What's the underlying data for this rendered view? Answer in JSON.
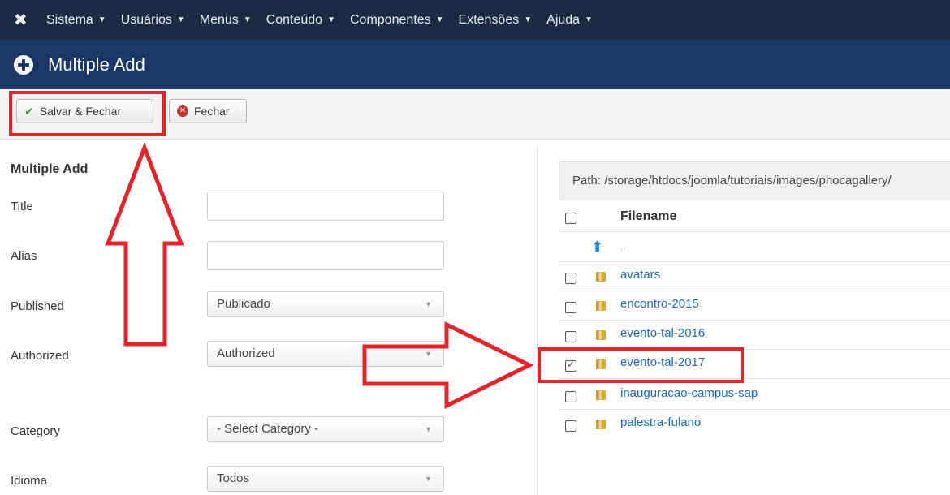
{
  "nav": {
    "logo_icon": "joomla-logo-icon",
    "items": [
      {
        "label": "Sistema"
      },
      {
        "label": "Usuários"
      },
      {
        "label": "Menus"
      },
      {
        "label": "Conteúdo"
      },
      {
        "label": "Componentes"
      },
      {
        "label": "Extensões"
      },
      {
        "label": "Ajuda"
      }
    ]
  },
  "header": {
    "title": "Multiple Add",
    "icon": "plus-circle-icon"
  },
  "toolbar": {
    "save_label": "Salvar & Fechar",
    "close_label": "Fechar"
  },
  "form": {
    "section_title": "Multiple Add",
    "title_label": "Title",
    "alias_label": "Alias",
    "published_label": "Published",
    "published_value": "Publicado",
    "authorized_label": "Authorized",
    "authorized_value": "Authorized",
    "category_label": "Category",
    "category_value": "- Select Category -",
    "language_label": "Idioma",
    "language_value": "Todos"
  },
  "browser": {
    "path": "Path: /storage/htdocs/joomla/tutoriais/images/phocagallery/",
    "column_header": "Filename",
    "parent": "..",
    "files": [
      {
        "name": "avatars",
        "checked": false
      },
      {
        "name": "encontro-2015",
        "checked": false
      },
      {
        "name": "evento-tal-2016",
        "checked": false
      },
      {
        "name": "evento-tal-2017",
        "checked": true
      },
      {
        "name": "inauguracao-campus-sap",
        "checked": false
      },
      {
        "name": "palestra-fulano",
        "checked": false
      }
    ]
  },
  "colors": {
    "nav_bg": "#1b2b43",
    "header_bg": "#1a3867",
    "highlight": "#e3242b",
    "link": "#1c6ab5"
  }
}
